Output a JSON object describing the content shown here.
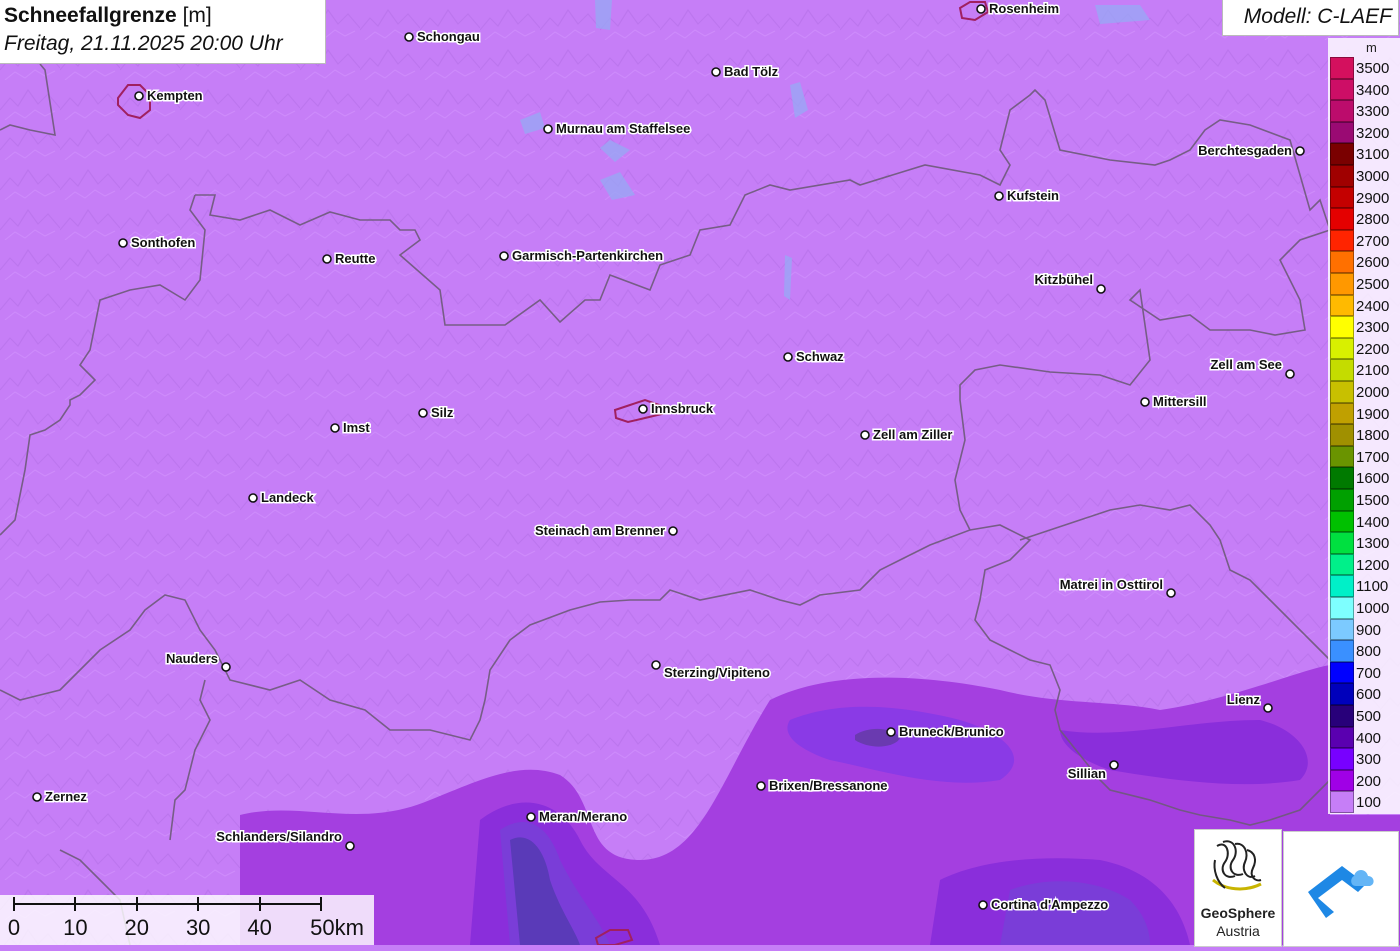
{
  "header": {
    "title_bold": "Schneefallgrenze",
    "title_unit": " [m]",
    "subtitle": "Freitag, 21.11.2025 20:00 Uhr"
  },
  "model": {
    "label": "Modell: C-LAEF"
  },
  "legend": {
    "unit": "m",
    "entries": [
      {
        "label": "3500",
        "color": "#d4105e"
      },
      {
        "label": "3400",
        "color": "#cd0e66"
      },
      {
        "label": "3300",
        "color": "#bc0c6c"
      },
      {
        "label": "3200",
        "color": "#9a0a73"
      },
      {
        "label": "3100",
        "color": "#7a0000"
      },
      {
        "label": "3000",
        "color": "#a00000"
      },
      {
        "label": "2900",
        "color": "#c40000"
      },
      {
        "label": "2800",
        "color": "#e40000"
      },
      {
        "label": "2700",
        "color": "#ff2400"
      },
      {
        "label": "2600",
        "color": "#ff7000"
      },
      {
        "label": "2500",
        "color": "#ff9800"
      },
      {
        "label": "2400",
        "color": "#ffba00"
      },
      {
        "label": "2300",
        "color": "#ffff00"
      },
      {
        "label": "2200",
        "color": "#d8f000"
      },
      {
        "label": "2100",
        "color": "#c4dc00"
      },
      {
        "label": "2000",
        "color": "#c8c000"
      },
      {
        "label": "1900",
        "color": "#c0a000"
      },
      {
        "label": "1800",
        "color": "#a09000"
      },
      {
        "label": "1700",
        "color": "#6a9400"
      },
      {
        "label": "1600",
        "color": "#007a00"
      },
      {
        "label": "1500",
        "color": "#00a000"
      },
      {
        "label": "1400",
        "color": "#00c000"
      },
      {
        "label": "1300",
        "color": "#00e040"
      },
      {
        "label": "1200",
        "color": "#00f08a"
      },
      {
        "label": "1100",
        "color": "#00f0c8"
      },
      {
        "label": "1000",
        "color": "#7effff"
      },
      {
        "label": "900",
        "color": "#7ccaff"
      },
      {
        "label": "800",
        "color": "#3a90ff"
      },
      {
        "label": "700",
        "color": "#0000ff"
      },
      {
        "label": "600",
        "color": "#0000bb"
      },
      {
        "label": "500",
        "color": "#28007a"
      },
      {
        "label": "400",
        "color": "#5a00b0"
      },
      {
        "label": "300",
        "color": "#7800ff"
      },
      {
        "label": "200",
        "color": "#a000e6"
      },
      {
        "label": "100",
        "color": "#c67ef7"
      }
    ]
  },
  "cities": [
    {
      "name": "Rosenheim"
    },
    {
      "name": "Schongau"
    },
    {
      "name": "Bad Tölz"
    },
    {
      "name": "Kempten"
    },
    {
      "name": "Murnau am Staffelsee"
    },
    {
      "name": "Berchtesgaden"
    },
    {
      "name": "Kufstein"
    },
    {
      "name": "Sonthofen"
    },
    {
      "name": "Reutte"
    },
    {
      "name": "Garmisch-Partenkirchen"
    },
    {
      "name": "Kitzbühel"
    },
    {
      "name": "Schwaz"
    },
    {
      "name": "Zell am See"
    },
    {
      "name": "Mittersill"
    },
    {
      "name": "Innsbruck"
    },
    {
      "name": "Silz"
    },
    {
      "name": "Imst"
    },
    {
      "name": "Zell am Ziller"
    },
    {
      "name": "Landeck"
    },
    {
      "name": "Steinach am Brenner"
    },
    {
      "name": "Matrei in Osttirol"
    },
    {
      "name": "Nauders"
    },
    {
      "name": "Sterzing/Vipiteno"
    },
    {
      "name": "Lienz"
    },
    {
      "name": "Bruneck/Brunico"
    },
    {
      "name": "Sillian"
    },
    {
      "name": "Brixen/Bressanone"
    },
    {
      "name": "Zernez"
    },
    {
      "name": "Meran/Merano"
    },
    {
      "name": "Schlanders/Silandro"
    },
    {
      "name": "Cortina d'Ampezzo"
    }
  ],
  "scale": {
    "labels": [
      "0",
      "10",
      "20",
      "30",
      "40",
      "50km"
    ]
  },
  "logos": {
    "geosphere_line1": "GeoSphere",
    "geosphere_line2": "Austria"
  }
}
